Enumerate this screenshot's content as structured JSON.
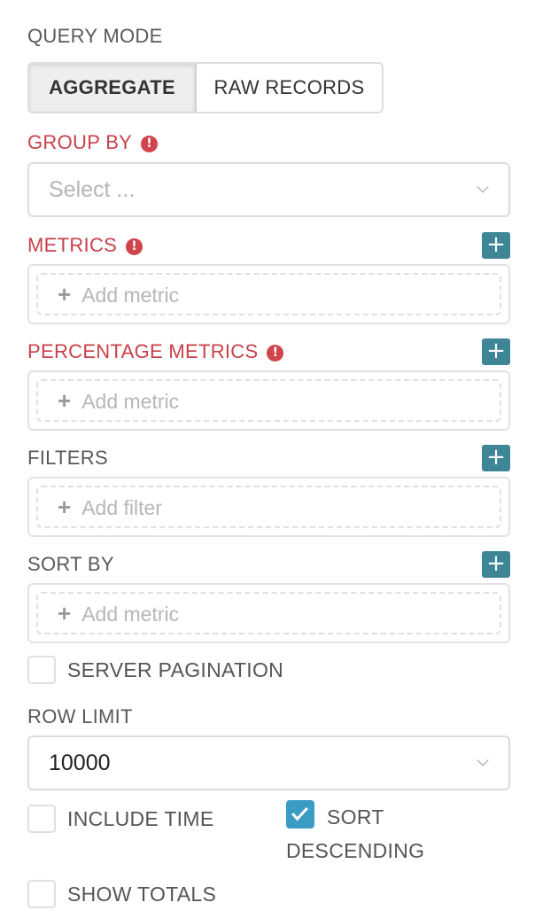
{
  "query_mode": {
    "label": "QUERY MODE",
    "options": [
      "AGGREGATE",
      "RAW RECORDS"
    ],
    "selected": "AGGREGATE"
  },
  "group_by": {
    "label": "GROUP BY",
    "placeholder": "Select ...",
    "error": true
  },
  "metrics": {
    "label": "METRICS",
    "add_text": "Add metric",
    "error": true
  },
  "percentage_metrics": {
    "label": "PERCENTAGE METRICS",
    "add_text": "Add metric",
    "error": true
  },
  "filters": {
    "label": "FILTERS",
    "add_text": "Add filter"
  },
  "sort_by": {
    "label": "SORT BY",
    "add_text": "Add metric"
  },
  "server_pagination": {
    "label": "SERVER PAGINATION",
    "checked": false
  },
  "row_limit": {
    "label": "ROW LIMIT",
    "value": "10000"
  },
  "include_time": {
    "label": "INCLUDE TIME",
    "checked": false
  },
  "sort_descending": {
    "label": "SORT DESCENDING",
    "checked": true
  },
  "show_totals": {
    "label": "SHOW TOTALS",
    "checked": false
  },
  "icons": {
    "error": "exclamation-circle-icon",
    "add": "plus-icon",
    "chevron": "chevron-down-icon",
    "check": "checkmark-icon"
  },
  "colors": {
    "error": "#c8414a",
    "accent": "#3e8596",
    "checkbox_checked": "#3a9cc4"
  }
}
